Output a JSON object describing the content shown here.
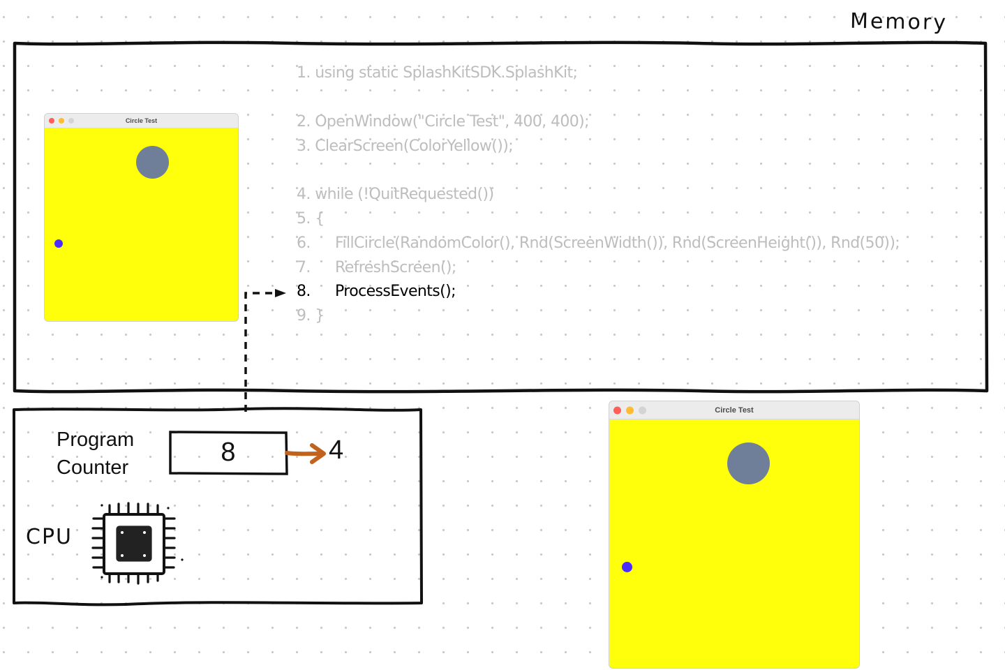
{
  "memory": {
    "title": "Memory",
    "code_lines": [
      {
        "num": "1.",
        "text": " using static SplashKitSDK.SplashKit;",
        "active": false
      },
      {
        "num": "2.",
        "text": " OpenWindow(\"Circle Test\", 400, 400);",
        "active": false
      },
      {
        "num": "3.",
        "text": " ClearScreen(ColorYellow());",
        "active": false
      },
      {
        "num": "4.",
        "text": " while (!QuitRequested())",
        "active": false
      },
      {
        "num": "5.",
        "text": " {",
        "active": false
      },
      {
        "num": "6.",
        "text": "FillCircle(RandomColor(), Rnd(ScreenWidth()), Rnd(ScreenHeight()), Rnd(50));",
        "active": false
      },
      {
        "num": "7.",
        "text": "RefreshScreen();",
        "active": false
      },
      {
        "num": "8.",
        "text": "ProcessEvents();",
        "active": true
      },
      {
        "num": "9.",
        "text": " }",
        "active": false
      }
    ],
    "window_preview": {
      "title": "Circle Test",
      "background_color": "#ffff0c",
      "circles": [
        {
          "color": "#6f7e99",
          "label": "large-slate-circle"
        },
        {
          "color": "#4a2cff",
          "label": "small-blue-circle"
        }
      ]
    }
  },
  "cpu": {
    "label": "CPU",
    "program_counter": {
      "label_line1": "Program",
      "label_line2": "Counter",
      "value": "8",
      "next_value": "4",
      "arrow_color": "#c2621c"
    }
  },
  "output_window": {
    "title": "Circle Test",
    "background_color": "#ffff0c",
    "circles": [
      {
        "color": "#6f7e99",
        "label": "large-slate-circle"
      },
      {
        "color": "#4a2cff",
        "label": "small-blue-circle"
      }
    ]
  },
  "colors": {
    "inactive_code": "#bdbdbd",
    "active_code": "#000000",
    "outline": "#111111"
  }
}
